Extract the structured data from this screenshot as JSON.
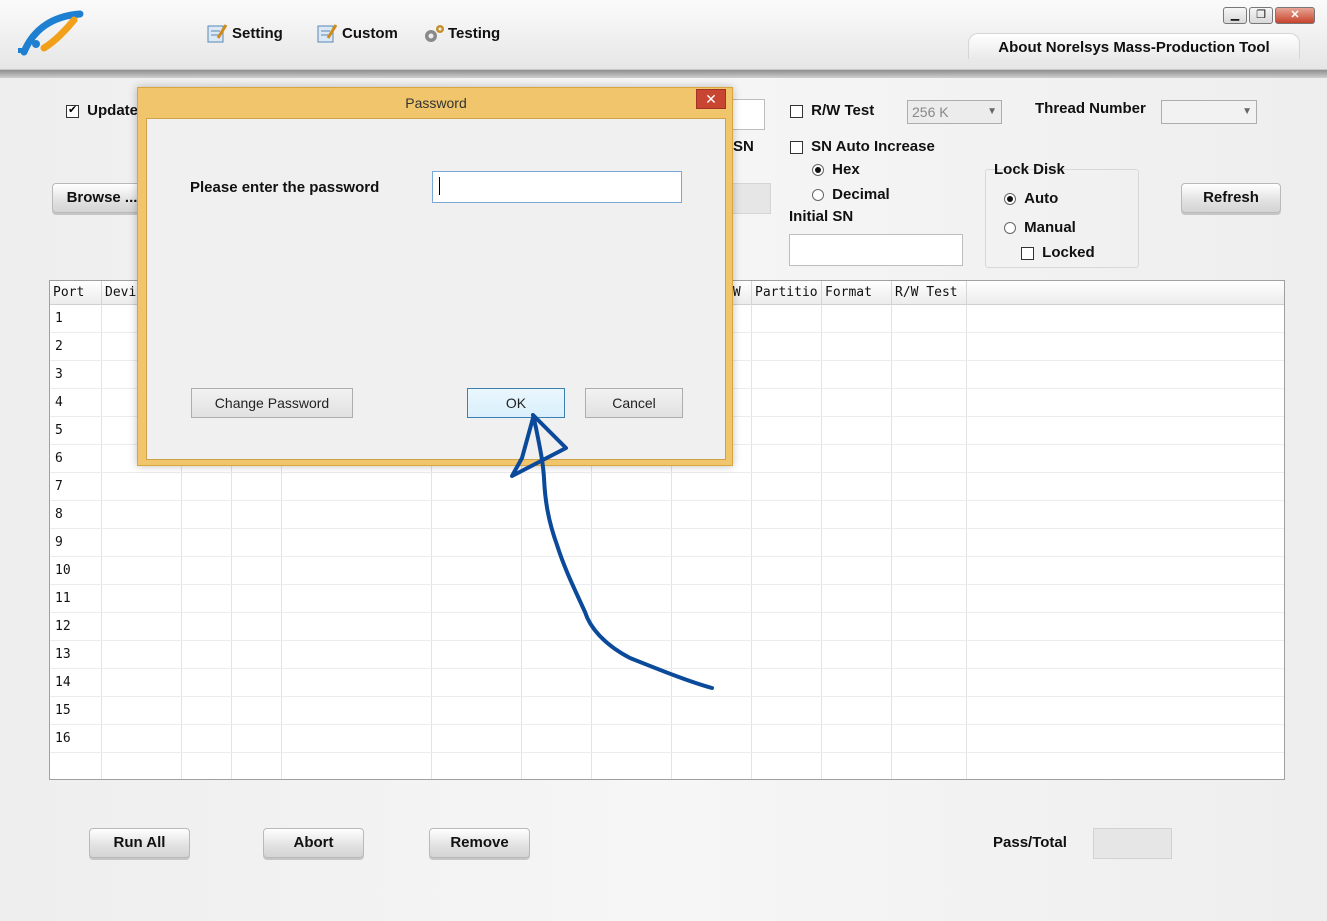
{
  "tabs": {
    "setting": "Setting",
    "custom": "Custom",
    "testing": "Testing",
    "about": "About Norelsys Mass-Production Tool"
  },
  "options": {
    "update_label": "Update",
    "update_checked": true,
    "browse_label": "Browse ...",
    "sn_label_fragment": "SN",
    "rw_test_label": "R/W Test",
    "rw_test_size": "256 K",
    "thread_number_label": "Thread Number",
    "sn_auto_increase_label": "SN Auto Increase",
    "hex_label": "Hex",
    "decimal_label": "Decimal",
    "initial_sn_label": "Initial SN",
    "lock_disk_label": "Lock Disk",
    "auto_label": "Auto",
    "manual_label": "Manual",
    "locked_label": "Locked",
    "refresh_label": "Refresh"
  },
  "grid": {
    "columns": [
      "Port",
      "Devi",
      "FW",
      "Partitio",
      "Format",
      "R/W Test"
    ],
    "rows": [
      "1",
      "2",
      "3",
      "4",
      "5",
      "6",
      "7",
      "8",
      "9",
      "10",
      "11",
      "12",
      "13",
      "14",
      "15",
      "16"
    ]
  },
  "bottom": {
    "run_all": "Run All",
    "abort": "Abort",
    "remove": "Remove",
    "pass_total_label": "Pass/Total"
  },
  "dialog": {
    "title": "Password",
    "close_glyph": "✕",
    "prompt": "Please enter the password",
    "change_password": "Change Password",
    "ok": "OK",
    "cancel": "Cancel"
  },
  "window": {
    "minimize": "▁",
    "restore": "❐",
    "close": "✕"
  },
  "colors": {
    "dialog_frame": "#f0c56b",
    "annotation_arrow": "#0b4a9a",
    "close_button": "#c84532"
  }
}
